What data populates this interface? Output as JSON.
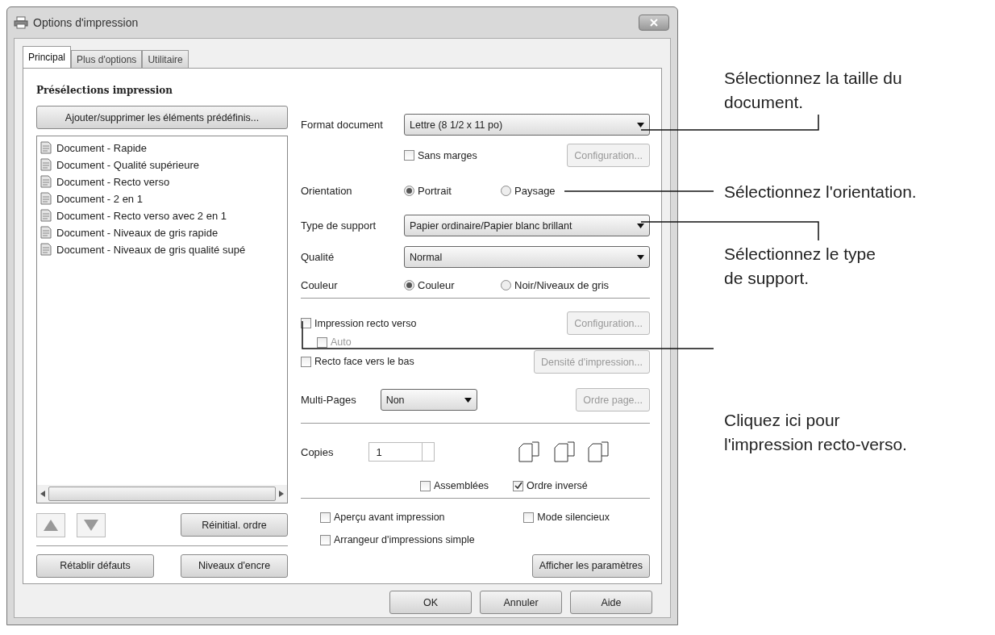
{
  "window": {
    "title": "Options d'impression"
  },
  "tabs": [
    {
      "label": "Principal",
      "selected": true
    },
    {
      "label": "Plus d'options",
      "selected": false
    },
    {
      "label": "Utilitaire",
      "selected": false
    }
  ],
  "presets": {
    "title": "Présélections impression",
    "add_button": "Ajouter/supprimer les éléments prédéfinis...",
    "items": [
      "Document - Rapide",
      "Document - Qualité supérieure",
      "Document - Recto verso",
      "Document - 2 en 1",
      "Document - Recto verso avec 2 en 1",
      "Document - Niveaux de gris rapide",
      "Document - Niveaux de gris qualité supé"
    ],
    "reset_order": "Réinitial. ordre",
    "restore_defaults": "Rétablir défauts",
    "ink_levels": "Niveaux d'encre"
  },
  "format": {
    "label": "Format document",
    "value": "Lettre (8 1/2 x 11 po)"
  },
  "borderless": {
    "label": "Sans marges",
    "checked": false
  },
  "borderless_setup": {
    "label": "Configuration...",
    "disabled": true
  },
  "orientation": {
    "label": "Orientation",
    "options": [
      {
        "label": "Portrait",
        "selected": true
      },
      {
        "label": "Paysage",
        "selected": false
      }
    ]
  },
  "media_type": {
    "label": "Type de support",
    "value": "Papier ordinaire/Papier blanc brillant"
  },
  "quality": {
    "label": "Qualité",
    "value": "Normal"
  },
  "color": {
    "label": "Couleur",
    "options": [
      {
        "label": "Couleur",
        "selected": true
      },
      {
        "label": "Noir/Niveaux de gris",
        "selected": false
      }
    ]
  },
  "duplex": {
    "label": "Impression recto verso",
    "checked": false
  },
  "duplex_setup": {
    "label": "Configuration...",
    "disabled": true
  },
  "auto": {
    "label": "Auto",
    "checked": false,
    "disabled": true
  },
  "density": {
    "label": "Densité d'impression...",
    "disabled": true
  },
  "face_down": {
    "label": "Recto face vers le bas",
    "checked": false
  },
  "multipage": {
    "label": "Multi-Pages",
    "value": "Non"
  },
  "page_order": {
    "label": "Ordre page...",
    "disabled": true
  },
  "copies": {
    "label": "Copies",
    "value": "1"
  },
  "collate": {
    "label": "Assemblées",
    "checked": false
  },
  "reverse": {
    "label": "Ordre inversé",
    "checked": true
  },
  "preview": {
    "label": "Aperçu avant impression",
    "checked": false
  },
  "silent": {
    "label": "Mode silencieux",
    "checked": false
  },
  "arranger": {
    "label": "Arrangeur d'impressions simple",
    "checked": false
  },
  "show_settings": "Afficher les paramètres",
  "buttons": [
    "OK",
    "Annuler",
    "Aide"
  ],
  "callouts": [
    {
      "lines": [
        "Sélectionnez la taille du",
        "document."
      ]
    },
    {
      "lines": [
        "Sélectionnez l'orientation."
      ]
    },
    {
      "lines": [
        "Sélectionnez le type",
        "de support."
      ]
    },
    {
      "lines": [
        "Cliquez ici pour",
        "l'impression recto-verso."
      ]
    }
  ]
}
